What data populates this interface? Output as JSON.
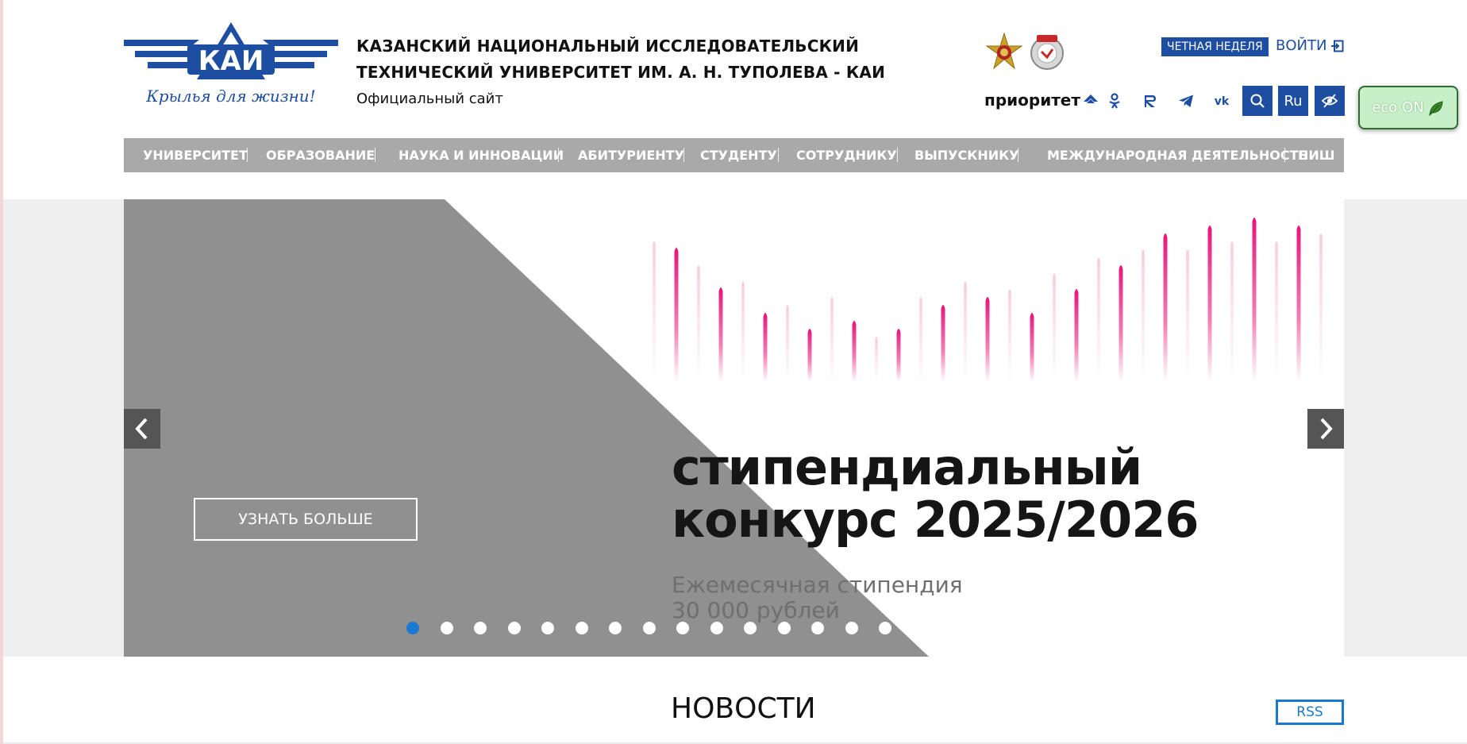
{
  "header": {
    "logo_text": "КАИ",
    "logo_slogan": "Крылья для жизни!",
    "title_line1": "КАЗАНСКИЙ НАЦИОНАЛЬНЫЙ ИССЛЕДОВАТЕЛЬСКИЙ",
    "title_line2": "ТЕХНИЧЕСКИЙ УНИВЕРСИТЕТ ИМ. А. Н. ТУПОЛЕВА - КАИ",
    "subtitle": "Официальный сайт",
    "week_badge": "ЧЕТНАЯ НЕДЕЛЯ",
    "login_label": "ВОЙТИ",
    "priority_label": "приоритет",
    "lang_label": "Ru",
    "eco_label": "eco ON"
  },
  "nav": {
    "items": [
      {
        "label": "УНИВЕРСИТЕТ"
      },
      {
        "label": "ОБРАЗОВАНИЕ"
      },
      {
        "label": "НАУКА И ИННОВАЦИИ"
      },
      {
        "label": "АБИТУРИЕНТУ"
      },
      {
        "label": "СТУДЕНТУ"
      },
      {
        "label": "СОТРУДНИКУ"
      },
      {
        "label": "ВЫПУСКНИКУ"
      },
      {
        "label": "МЕЖДУНАРОДНАЯ ДЕЯТЕЛЬНОСТЬ"
      },
      {
        "label": "ПИШ"
      }
    ]
  },
  "slider": {
    "headline_line1": "стипендиальный",
    "headline_line2": "конкурс 2025/2026",
    "sub_line1": "Ежемесячная стипендия",
    "sub_line2": "30 000 рублей",
    "button_label": "УЗНАТЬ БОЛЬШЕ",
    "slide_count": 15,
    "active_slide": 1,
    "accent_color": "#e8147c",
    "overlay_color": "#8e8e8e"
  },
  "news": {
    "title": "НОВОСТИ",
    "rss_label": "RSS"
  },
  "colors": {
    "brand_blue": "#1d4ea1",
    "nav_gray": "#a9a9a9",
    "dot_active": "#1978d2",
    "eco_green": "#c8f0c8"
  },
  "icons": {
    "social": [
      "odnoklassniki-icon",
      "rutube-icon",
      "telegram-icon",
      "vk-icon"
    ],
    "search": "search-icon",
    "accessibility": "low-vision-icon"
  }
}
